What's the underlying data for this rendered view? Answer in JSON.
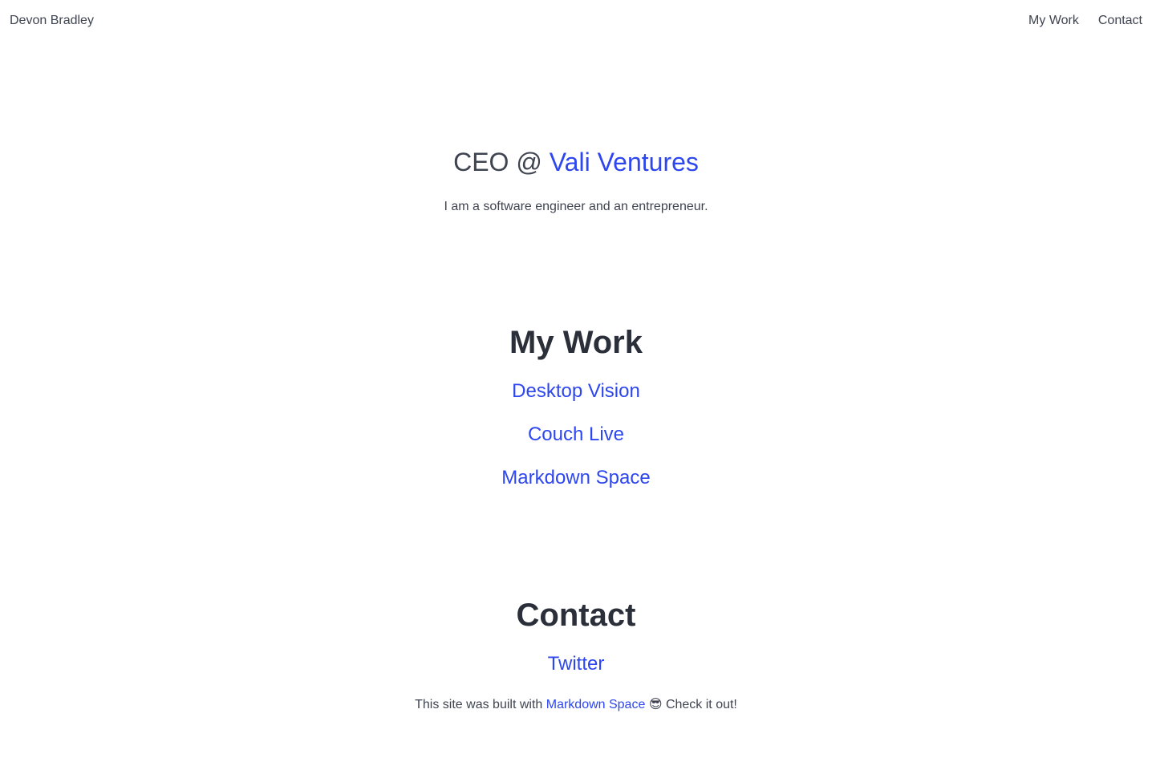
{
  "header": {
    "site_name": "Devon Bradley",
    "nav": [
      {
        "label": "My Work"
      },
      {
        "label": "Contact"
      }
    ]
  },
  "hero": {
    "role": "CEO @ ",
    "company": "Vali Ventures",
    "tagline": "I am a software engineer and an entrepreneur."
  },
  "work": {
    "title": "My Work",
    "items": [
      {
        "label": "Desktop Vision"
      },
      {
        "label": "Couch Live"
      },
      {
        "label": "Markdown Space"
      }
    ]
  },
  "contact": {
    "title": "Contact",
    "items": [
      {
        "label": "Twitter"
      }
    ]
  },
  "footer": {
    "prefix": "This site was built with ",
    "link": "Markdown Space",
    "emoji": "😎",
    "suffix": " Check it out!"
  },
  "colors": {
    "accent": "#2d46ee",
    "text": "#3f4451",
    "heading": "#2b2f3a"
  }
}
